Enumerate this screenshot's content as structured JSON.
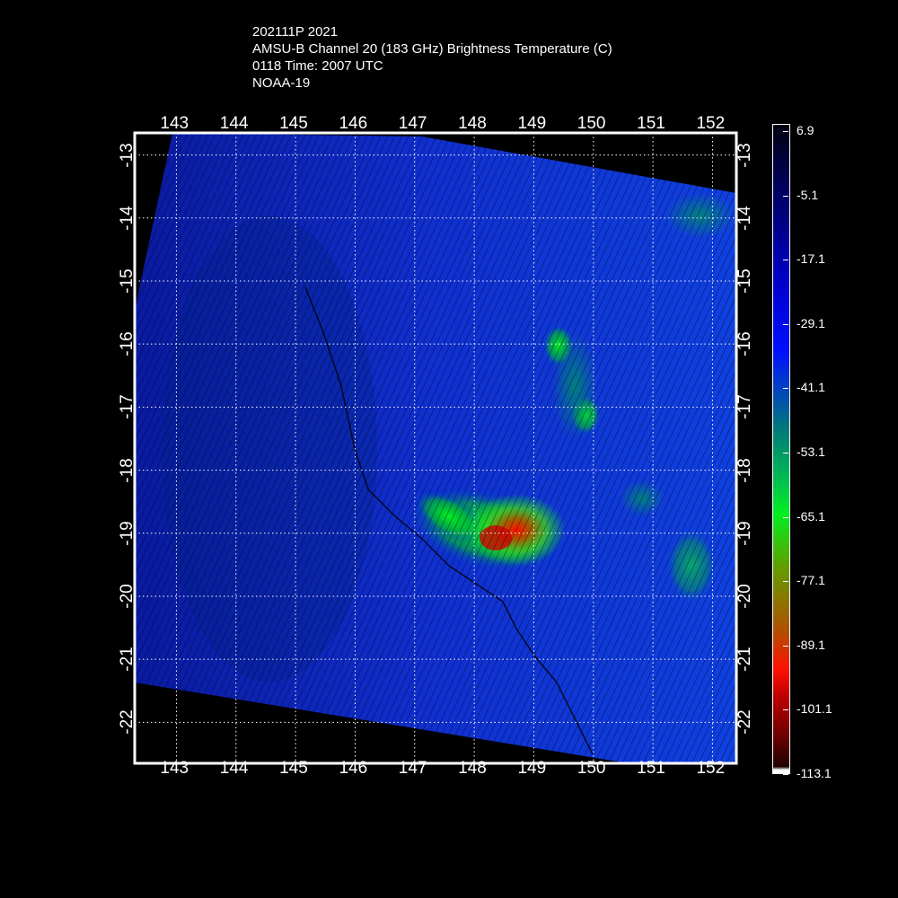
{
  "title": {
    "line1": "202111P 2021",
    "line2": "AMSU-B Channel 20 (183 GHz) Brightness Temperature (C)",
    "line3": "0118 Time: 2007 UTC",
    "line4": "NOAA-19"
  },
  "map": {
    "lon_ticks": [
      "143",
      "144",
      "145",
      "146",
      "147",
      "148",
      "149",
      "150",
      "151",
      "152"
    ],
    "lat_ticks": [
      "-13",
      "-14",
      "-15",
      "-16",
      "-17",
      "-18",
      "-19",
      "-20",
      "-21",
      "-22"
    ],
    "lon_range": [
      142.3,
      152.4
    ],
    "lat_range": [
      -12.65,
      -22.65
    ]
  },
  "colorbar": {
    "labels": [
      "6.9",
      "-5.1",
      "-17.1",
      "-29.1",
      "-41.1",
      "-53.1",
      "-65.1",
      "-77.1",
      "-89.1",
      "-101.1",
      "-113.1"
    ],
    "units": "C",
    "colors": {
      "warm": "#000010",
      "mid": "#0010ff",
      "green": "#00f020",
      "red": "#ff1000",
      "cold": "#200000"
    }
  }
}
